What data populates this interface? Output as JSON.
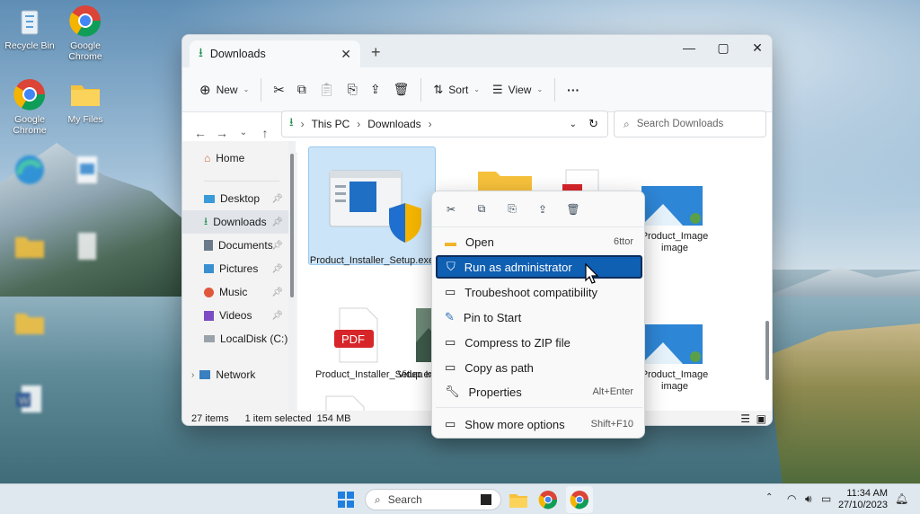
{
  "desktop": {
    "icons": [
      {
        "label": "Recycle Bin"
      },
      {
        "label": "Google Chrome"
      },
      {
        "label": "Google Chrome"
      },
      {
        "label": "My Files"
      }
    ]
  },
  "window": {
    "tab_title": "Downloads",
    "toolbar": {
      "new_label": "New",
      "sort_label": "Sort",
      "view_label": "View",
      "more_label": "···"
    },
    "breadcrumb": [
      "This PC",
      "Downloads"
    ],
    "search_placeholder": "Search Downloads",
    "nav": [
      {
        "label": "Home"
      },
      {
        "label": "Desktop"
      },
      {
        "label": "Downloads"
      },
      {
        "label": "Documents"
      },
      {
        "label": "Pictures"
      },
      {
        "label": "Music"
      },
      {
        "label": "Videos"
      },
      {
        "label": "LocalDisk (C:)"
      },
      {
        "label": "Network"
      }
    ],
    "files": {
      "selected_name": "Product_Installer_Setup.exe",
      "pdf_name": "Product_Installer_Setup.exe",
      "pdf_badge": "PDF",
      "video_name": "Video In imagre",
      "image1_name": "Product_Image image",
      "image2_name": "Product_Image image"
    },
    "status": {
      "items": "27 items",
      "selected": "1 item selected",
      "size": "154 MB"
    }
  },
  "context_menu": {
    "items": [
      {
        "label": "Open",
        "shortcut": "6ttor"
      },
      {
        "label": "Run as administrator",
        "shortcut": ""
      },
      {
        "label": "Troubeshoot compatibility",
        "shortcut": ""
      },
      {
        "label": "Pin to Start",
        "shortcut": ""
      },
      {
        "label": "Compress to ZIP file",
        "shortcut": ""
      },
      {
        "label": "Copy as path",
        "shortcut": ""
      },
      {
        "label": "Properties",
        "shortcut": "Alt+Enter"
      },
      {
        "label": "Show more options",
        "shortcut": "Shift+F10"
      }
    ]
  },
  "taskbar": {
    "search_label": "Search",
    "time": "11:34 AM",
    "date": "27/10/2023"
  },
  "colors": {
    "accent": "#0f5fb3",
    "folder": "#f6c13b",
    "pdf": "#d7262a"
  }
}
